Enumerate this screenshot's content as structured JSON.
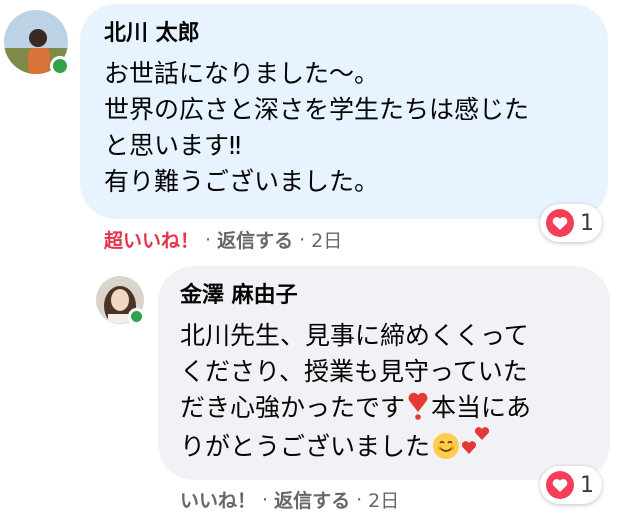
{
  "comment1": {
    "author": "北川 太郎",
    "lines": [
      "お世話になりました〜。",
      "世界の広さと深さを学生たちは感じた",
      "と思います‼",
      "有り難うございました。"
    ],
    "reaction_count": "1",
    "actions": {
      "like": "超いいね！",
      "reply": "返信する",
      "time": "2日",
      "sep": "·"
    }
  },
  "reply1": {
    "author": "金澤 麻由子",
    "lines": [
      "北川先生、見事に締めくくって",
      "くださり、授業も見守っていた",
      "だき心強かったです",
      "りがとうございました"
    ],
    "line3_suffix": "本当にあ",
    "reaction_count": "1",
    "actions": {
      "like": "いいね！",
      "reply": "返信する",
      "time": "2日",
      "sep": "·"
    }
  },
  "colors": {
    "online": "#31a24c",
    "love": "#f33e58",
    "super_like_text": "#e4344a",
    "bubble_blue": "#e7f3ff",
    "bubble_gray": "#f0f2f5"
  },
  "icons": [
    "love-reaction-icon",
    "heart-exclamation-icon",
    "smiling-face-icon",
    "two-hearts-icon"
  ]
}
